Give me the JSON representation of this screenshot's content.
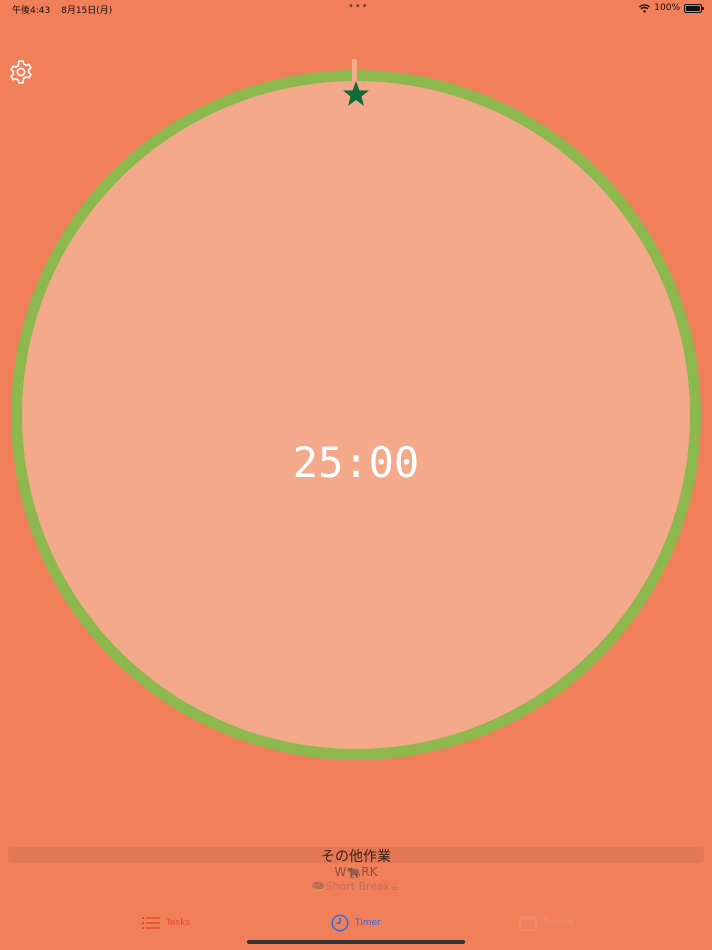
{
  "status": {
    "time": "午後4:43",
    "date": "8月15日(月)",
    "dots": "•••",
    "battery": "100%"
  },
  "timer": {
    "display": "25:00",
    "progress": 0
  },
  "task_picker": {
    "items": [
      "その他作業",
      "W🐂RK",
      "🍩Short Break☕"
    ]
  },
  "tabs": {
    "tasks": "Tasks",
    "timer": "Timer",
    "report": "Report"
  },
  "colors": {
    "background": "#F17F59",
    "inner_circle": "#F4A98A",
    "ring": "#8DB84D",
    "star": "#0E6B3A",
    "tab_selected": "#2F6BE8",
    "tab_tasks": "#E34A2B",
    "tab_disabled": "#EF8C72"
  },
  "icons": {
    "settings": "gear-icon",
    "progress_marker": "star-icon",
    "tasks": "list-icon",
    "timer": "clock-icon",
    "report": "calendar-icon",
    "wifi": "wifi-icon",
    "battery": "battery-icon"
  }
}
